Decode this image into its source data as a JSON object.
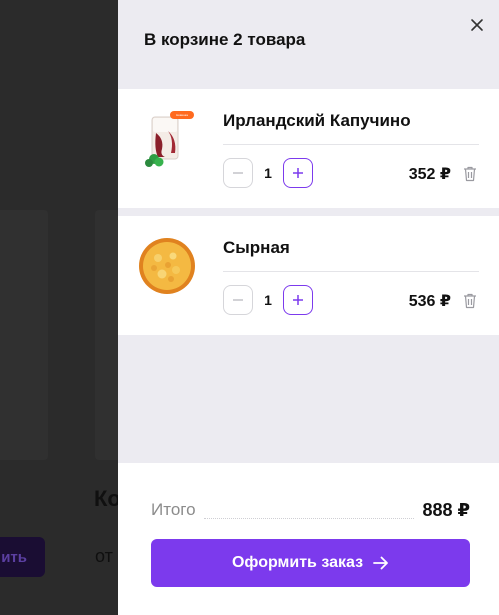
{
  "background": {
    "heading_fragment": "Ко",
    "button_fragment": "ить",
    "text_fragment": "от"
  },
  "cart": {
    "title": "В корзине 2 товара",
    "items": [
      {
        "name": "Ирландский Капучино",
        "quantity": "1",
        "price": "352 ₽",
        "badge": "Новинка",
        "image_icon": "coffee-drink-image"
      },
      {
        "name": "Сырная",
        "quantity": "1",
        "price": "536 ₽",
        "image_icon": "pizza-image"
      }
    ],
    "total_label": "Итого",
    "total_value": "888 ₽",
    "checkout_label": "Оформить заказ"
  },
  "colors": {
    "accent": "#7c3aed",
    "panel_bg": "#ecebf1",
    "overlay_bg": "#2b2b2b"
  }
}
